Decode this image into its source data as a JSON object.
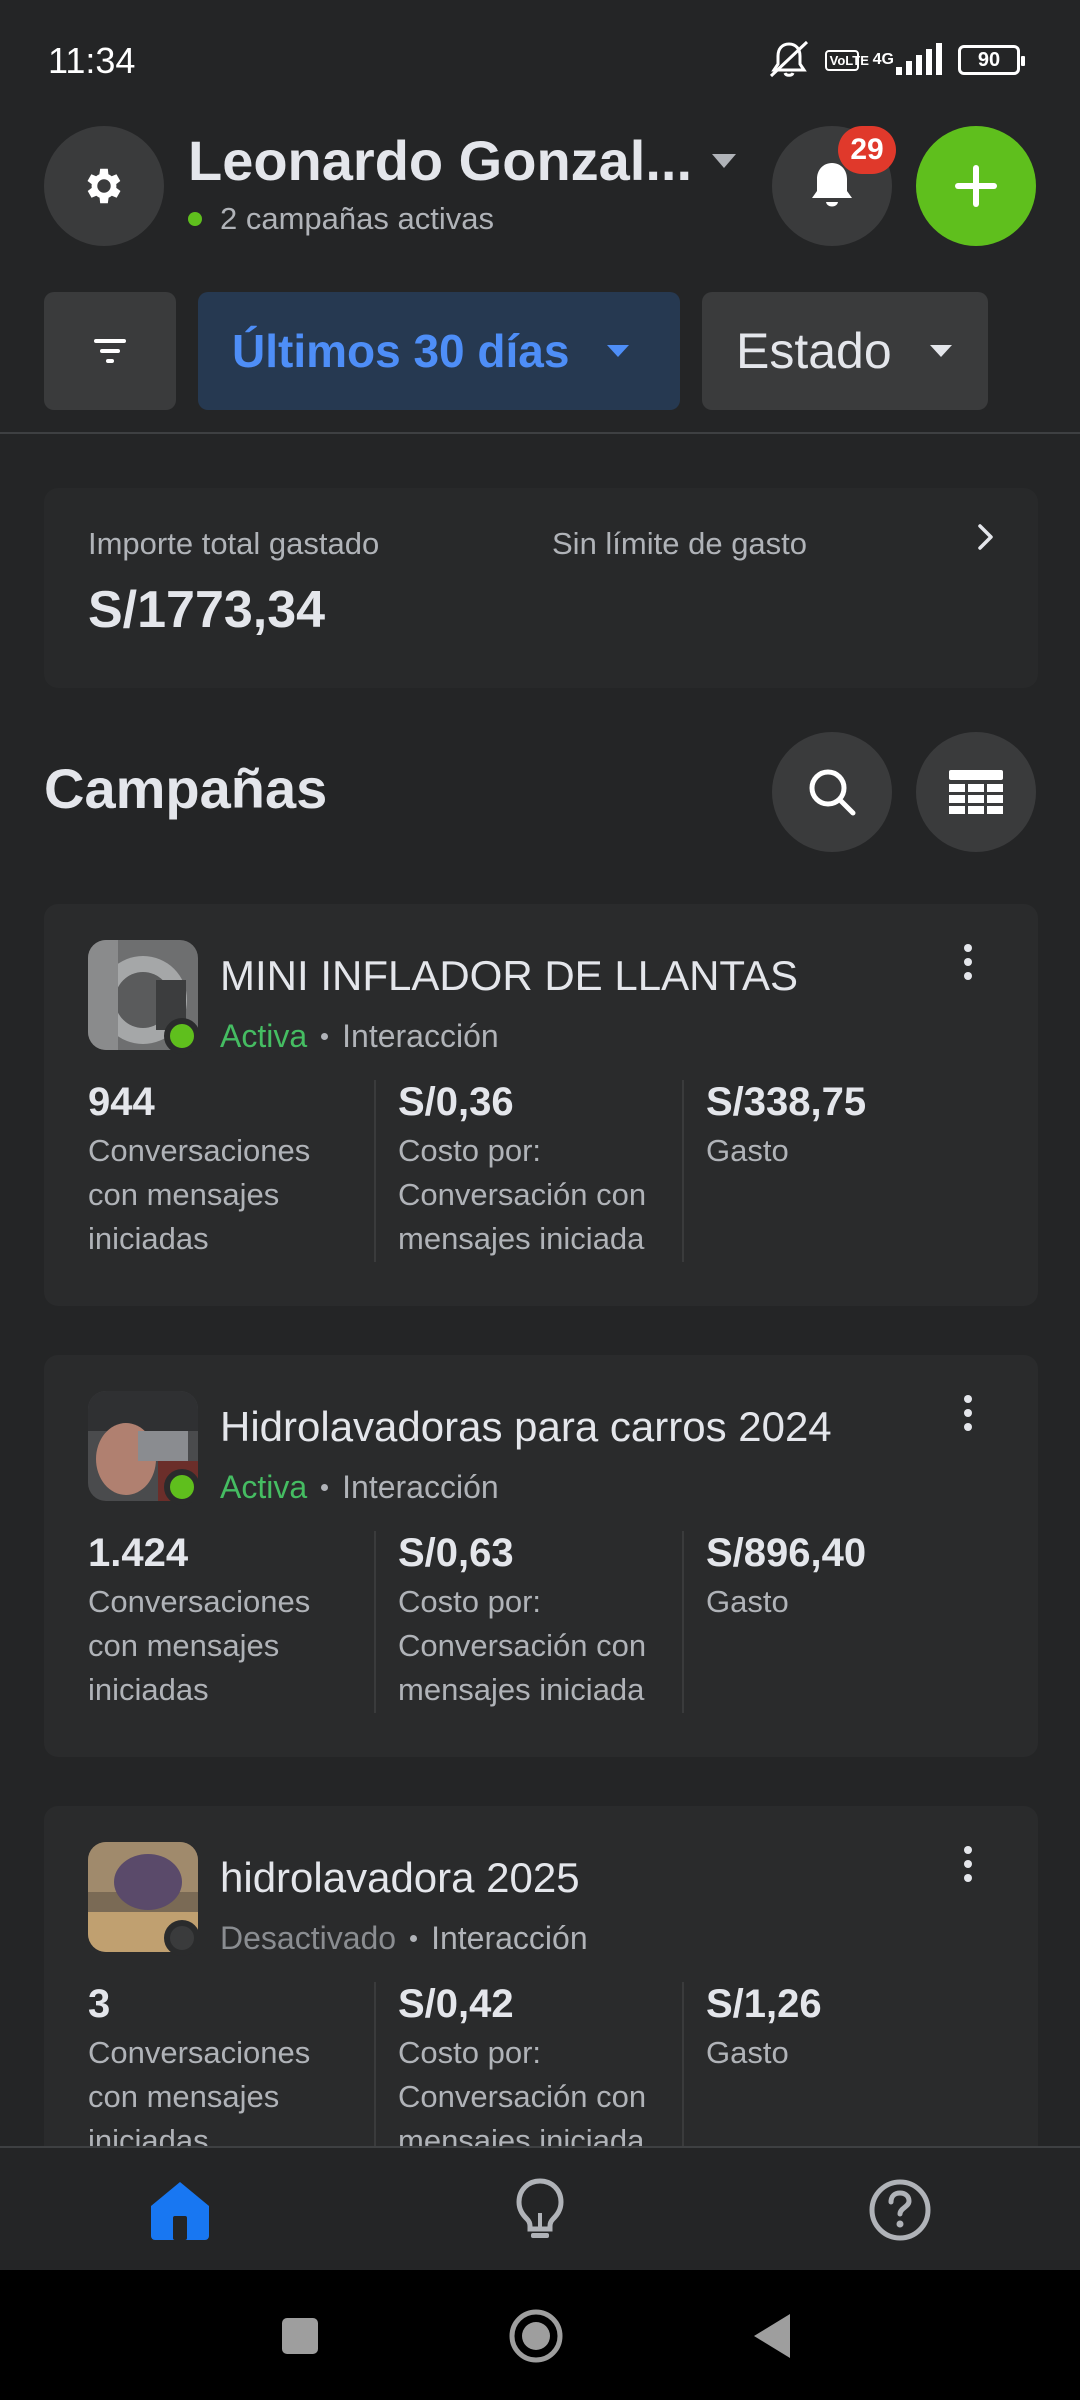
{
  "status_bar": {
    "time": "11:34",
    "volte": "VoLTE",
    "network": "4G",
    "battery": "90"
  },
  "header": {
    "account_name": "Leonardo Gonzal...",
    "active_campaigns": "2 campañas activas",
    "notification_count": "29",
    "icons": [
      "gear-icon",
      "bell-icon",
      "plus-icon",
      "caret-down-icon"
    ]
  },
  "filters": {
    "date_range": "Últimos 30 días",
    "state": "Estado"
  },
  "spend": {
    "total_label": "Importe total gastado",
    "total_value": "S/1773,34",
    "limit_label": "Sin límite de gasto"
  },
  "campaigns_section": {
    "title": "Campañas"
  },
  "campaigns": [
    {
      "name": "MINI INFLADOR DE LLANTAS",
      "status": "Activa",
      "type": "Interacción",
      "results": "944",
      "results_label": "Conversaciones con mensajes iniciadas",
      "cost": "S/0,36",
      "cost_label": "Costo por: Conversación con mensajes iniciada",
      "spend": "S/338,75",
      "spend_label": "Gasto"
    },
    {
      "name": "Hidrolavadoras para carros 2024",
      "status": "Activa",
      "type": "Interacción",
      "results": "1.424",
      "results_label": "Conversaciones con mensajes iniciadas",
      "cost": "S/0,63",
      "cost_label": "Costo por: Conversación con mensajes iniciada",
      "spend": "S/896,40",
      "spend_label": "Gasto"
    },
    {
      "name": "hidrolavadora 2025",
      "status": "Desactivado",
      "type": "Interacción",
      "results": "3",
      "results_label": "Conversaciones con mensajes iniciadas",
      "cost": "S/0,42",
      "cost_label": "Costo por: Conversación con mensajes iniciada",
      "spend": "S/1,26",
      "spend_label": "Gasto"
    }
  ],
  "colors": {
    "background": "#242526",
    "card": "#2a2b2c",
    "accent_blue": "#4e8ef7",
    "accent_green": "#5fbf1d",
    "status_active": "#45bd62",
    "badge_red": "#e0392b"
  },
  "bottom_nav": [
    "home-icon",
    "lightbulb-icon",
    "help-icon"
  ]
}
